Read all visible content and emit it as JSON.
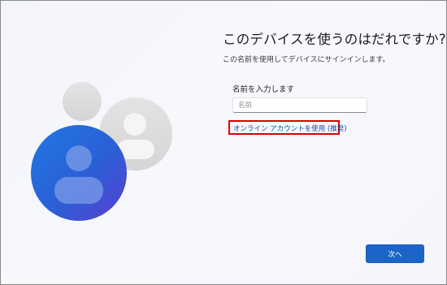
{
  "page": {
    "title": "このデバイスを使うのはだれですか?",
    "subtitle": "この名前を使用してデバイスにサインインします。"
  },
  "form": {
    "name_label": "名前を入力します",
    "name_placeholder": "名前",
    "name_value": ""
  },
  "links": {
    "online_account": "オンライン アカウントを使用 (推奨)"
  },
  "footer": {
    "next_label": "次へ"
  },
  "colors": {
    "accent": "#1c64c8",
    "link": "#0b4fa3",
    "highlight_border": "#e00000"
  },
  "icons": {
    "main_avatar": "user-avatar-icon",
    "background_avatar": "user-avatar-icon"
  }
}
